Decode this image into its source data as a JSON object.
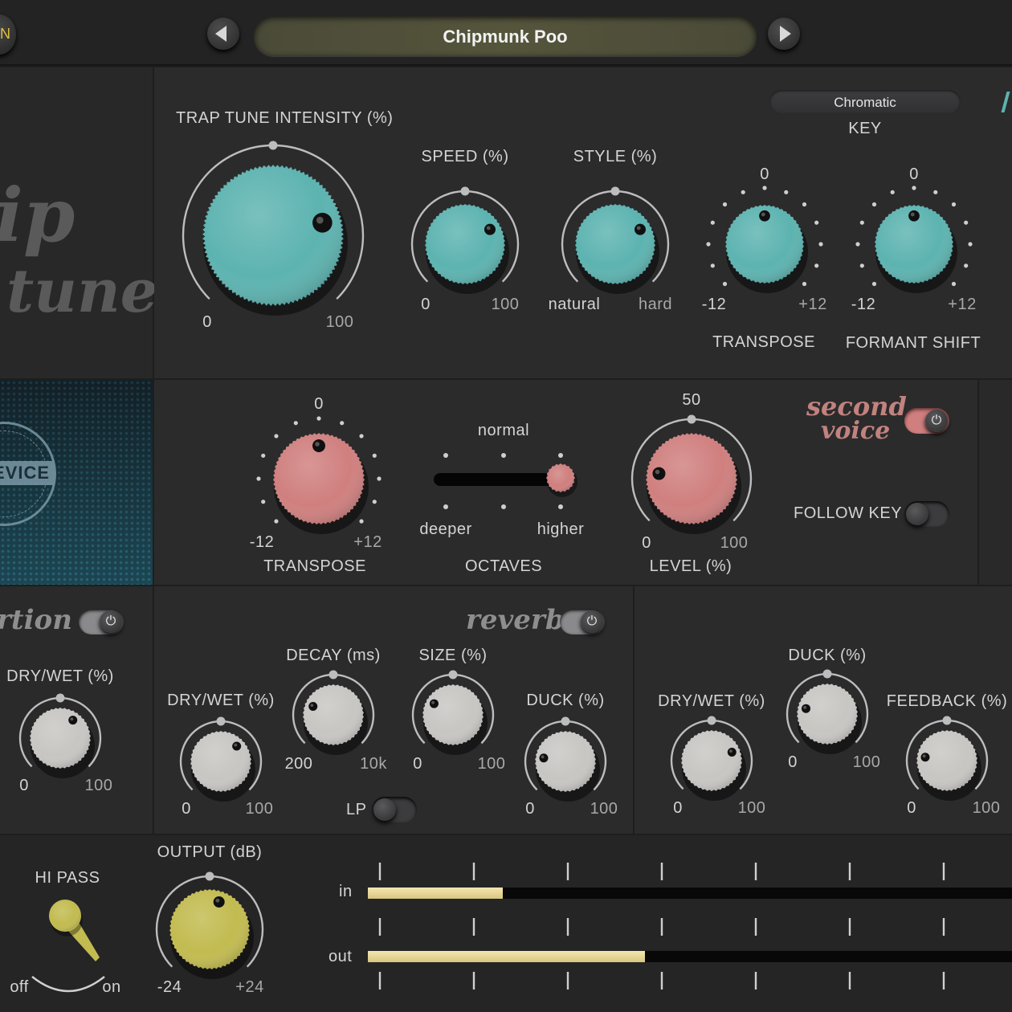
{
  "header": {
    "power_label": "N",
    "preset_name": "Chipmunk Poo",
    "prev_icon": "left-triangle",
    "next_icon": "right-triangle"
  },
  "logo": {
    "line1": "ip",
    "line2": "tune"
  },
  "badge": {
    "text": "EVICE"
  },
  "tune": {
    "intensity": {
      "label": "TRAP TUNE INTENSITY (%)",
      "min": "0",
      "max": "100",
      "value": 0.78
    },
    "speed": {
      "label": "SPEED (%)",
      "min": "0",
      "max": "100",
      "value": 0.72
    },
    "style": {
      "label": "STYLE (%)",
      "min": "natural",
      "max": "hard",
      "value": 0.72
    },
    "key": {
      "value": "Chromatic",
      "label": "KEY"
    },
    "transpose": {
      "label": "TRANSPOSE",
      "min": "-12",
      "max": "+12",
      "center": "0",
      "value": 0
    },
    "formant": {
      "label": "FORMANT SHIFT",
      "min": "-12",
      "max": "+12",
      "center": "0",
      "value": 0
    }
  },
  "second_voice": {
    "title_line1": "second",
    "title_line2": "voice",
    "enabled": true,
    "transpose": {
      "label": "TRANSPOSE",
      "min": "-12",
      "max": "+12",
      "center": "0",
      "value": 0
    },
    "octaves": {
      "label": "OCTAVES",
      "top": "normal",
      "left": "deeper",
      "right": "higher",
      "value": 1.0
    },
    "level": {
      "label": "LEVEL (%)",
      "min": "0",
      "max": "100",
      "center": "50",
      "value": 0.2
    },
    "follow_key": {
      "label": "FOLLOW KEY",
      "enabled": false
    }
  },
  "distortion": {
    "title": "rtion",
    "enabled": true,
    "drywet": {
      "label": "DRY/WET (%)",
      "min": "0",
      "max": "100",
      "value": 0.63
    }
  },
  "reverb": {
    "title": "reverb",
    "enabled": true,
    "drywet": {
      "label": "DRY/WET (%)",
      "min": "0",
      "max": "100",
      "value": 0.67
    },
    "decay": {
      "label": "DECAY (ms)",
      "min": "200",
      "max": "10k",
      "value": 0.25
    },
    "size": {
      "label": "SIZE (%)",
      "min": "0",
      "max": "100",
      "value": 0.28
    },
    "duck": {
      "label": "DUCK (%)",
      "min": "0",
      "max": "100",
      "value": 0.2
    },
    "lp": {
      "label": "LP",
      "enabled": false
    }
  },
  "delay": {
    "drywet": {
      "label": "DRY/WET (%)",
      "min": "0",
      "max": "100",
      "value": 0.75
    },
    "duck": {
      "label": "DUCK (%)",
      "min": "0",
      "max": "100",
      "value": 0.22
    },
    "feedback": {
      "label": "FEEDBACK (%)",
      "min": "0",
      "max": "100",
      "value": 0.2
    }
  },
  "output_section": {
    "hipass": {
      "label": "HI PASS",
      "off": "off",
      "on": "on",
      "value": 0.9
    },
    "output": {
      "label": "OUTPUT (dB)",
      "min": "-24",
      "max": "+24",
      "value": 0.57
    },
    "meters": {
      "in_label": "in",
      "out_label": "out",
      "in_level": 0.21,
      "out_level": 0.43
    }
  },
  "colors": {
    "teal": "#5cb3b0",
    "pink": "#cf7f7e",
    "grey": "#c8c6c3",
    "olive": "#c2bb50",
    "script_pink": "#c2827e"
  }
}
